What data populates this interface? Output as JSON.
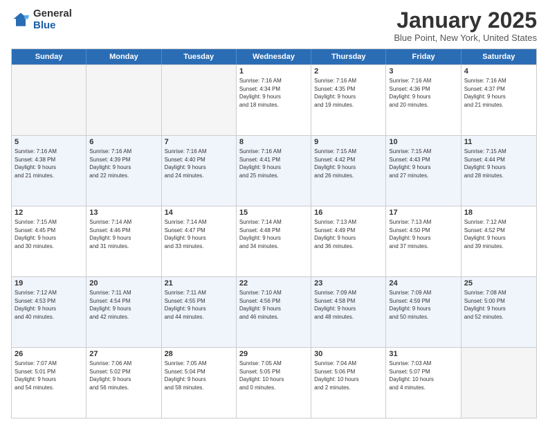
{
  "logo": {
    "general": "General",
    "blue": "Blue"
  },
  "title": "January 2025",
  "location": "Blue Point, New York, United States",
  "days_of_week": [
    "Sunday",
    "Monday",
    "Tuesday",
    "Wednesday",
    "Thursday",
    "Friday",
    "Saturday"
  ],
  "weeks": [
    [
      {
        "day": "",
        "empty": true
      },
      {
        "day": "",
        "empty": true
      },
      {
        "day": "",
        "empty": true
      },
      {
        "day": "1",
        "info": "Sunrise: 7:16 AM\nSunset: 4:34 PM\nDaylight: 9 hours\nand 18 minutes."
      },
      {
        "day": "2",
        "info": "Sunrise: 7:16 AM\nSunset: 4:35 PM\nDaylight: 9 hours\nand 19 minutes."
      },
      {
        "day": "3",
        "info": "Sunrise: 7:16 AM\nSunset: 4:36 PM\nDaylight: 9 hours\nand 20 minutes."
      },
      {
        "day": "4",
        "info": "Sunrise: 7:16 AM\nSunset: 4:37 PM\nDaylight: 9 hours\nand 21 minutes."
      }
    ],
    [
      {
        "day": "5",
        "info": "Sunrise: 7:16 AM\nSunset: 4:38 PM\nDaylight: 9 hours\nand 21 minutes."
      },
      {
        "day": "6",
        "info": "Sunrise: 7:16 AM\nSunset: 4:39 PM\nDaylight: 9 hours\nand 22 minutes."
      },
      {
        "day": "7",
        "info": "Sunrise: 7:16 AM\nSunset: 4:40 PM\nDaylight: 9 hours\nand 24 minutes."
      },
      {
        "day": "8",
        "info": "Sunrise: 7:16 AM\nSunset: 4:41 PM\nDaylight: 9 hours\nand 25 minutes."
      },
      {
        "day": "9",
        "info": "Sunrise: 7:15 AM\nSunset: 4:42 PM\nDaylight: 9 hours\nand 26 minutes."
      },
      {
        "day": "10",
        "info": "Sunrise: 7:15 AM\nSunset: 4:43 PM\nDaylight: 9 hours\nand 27 minutes."
      },
      {
        "day": "11",
        "info": "Sunrise: 7:15 AM\nSunset: 4:44 PM\nDaylight: 9 hours\nand 28 minutes."
      }
    ],
    [
      {
        "day": "12",
        "info": "Sunrise: 7:15 AM\nSunset: 4:45 PM\nDaylight: 9 hours\nand 30 minutes."
      },
      {
        "day": "13",
        "info": "Sunrise: 7:14 AM\nSunset: 4:46 PM\nDaylight: 9 hours\nand 31 minutes."
      },
      {
        "day": "14",
        "info": "Sunrise: 7:14 AM\nSunset: 4:47 PM\nDaylight: 9 hours\nand 33 minutes."
      },
      {
        "day": "15",
        "info": "Sunrise: 7:14 AM\nSunset: 4:48 PM\nDaylight: 9 hours\nand 34 minutes."
      },
      {
        "day": "16",
        "info": "Sunrise: 7:13 AM\nSunset: 4:49 PM\nDaylight: 9 hours\nand 36 minutes."
      },
      {
        "day": "17",
        "info": "Sunrise: 7:13 AM\nSunset: 4:50 PM\nDaylight: 9 hours\nand 37 minutes."
      },
      {
        "day": "18",
        "info": "Sunrise: 7:12 AM\nSunset: 4:52 PM\nDaylight: 9 hours\nand 39 minutes."
      }
    ],
    [
      {
        "day": "19",
        "info": "Sunrise: 7:12 AM\nSunset: 4:53 PM\nDaylight: 9 hours\nand 40 minutes."
      },
      {
        "day": "20",
        "info": "Sunrise: 7:11 AM\nSunset: 4:54 PM\nDaylight: 9 hours\nand 42 minutes."
      },
      {
        "day": "21",
        "info": "Sunrise: 7:11 AM\nSunset: 4:55 PM\nDaylight: 9 hours\nand 44 minutes."
      },
      {
        "day": "22",
        "info": "Sunrise: 7:10 AM\nSunset: 4:56 PM\nDaylight: 9 hours\nand 46 minutes."
      },
      {
        "day": "23",
        "info": "Sunrise: 7:09 AM\nSunset: 4:58 PM\nDaylight: 9 hours\nand 48 minutes."
      },
      {
        "day": "24",
        "info": "Sunrise: 7:09 AM\nSunset: 4:59 PM\nDaylight: 9 hours\nand 50 minutes."
      },
      {
        "day": "25",
        "info": "Sunrise: 7:08 AM\nSunset: 5:00 PM\nDaylight: 9 hours\nand 52 minutes."
      }
    ],
    [
      {
        "day": "26",
        "info": "Sunrise: 7:07 AM\nSunset: 5:01 PM\nDaylight: 9 hours\nand 54 minutes."
      },
      {
        "day": "27",
        "info": "Sunrise: 7:06 AM\nSunset: 5:02 PM\nDaylight: 9 hours\nand 56 minutes."
      },
      {
        "day": "28",
        "info": "Sunrise: 7:05 AM\nSunset: 5:04 PM\nDaylight: 9 hours\nand 58 minutes."
      },
      {
        "day": "29",
        "info": "Sunrise: 7:05 AM\nSunset: 5:05 PM\nDaylight: 10 hours\nand 0 minutes."
      },
      {
        "day": "30",
        "info": "Sunrise: 7:04 AM\nSunset: 5:06 PM\nDaylight: 10 hours\nand 2 minutes."
      },
      {
        "day": "31",
        "info": "Sunrise: 7:03 AM\nSunset: 5:07 PM\nDaylight: 10 hours\nand 4 minutes."
      },
      {
        "day": "",
        "empty": true
      }
    ]
  ]
}
